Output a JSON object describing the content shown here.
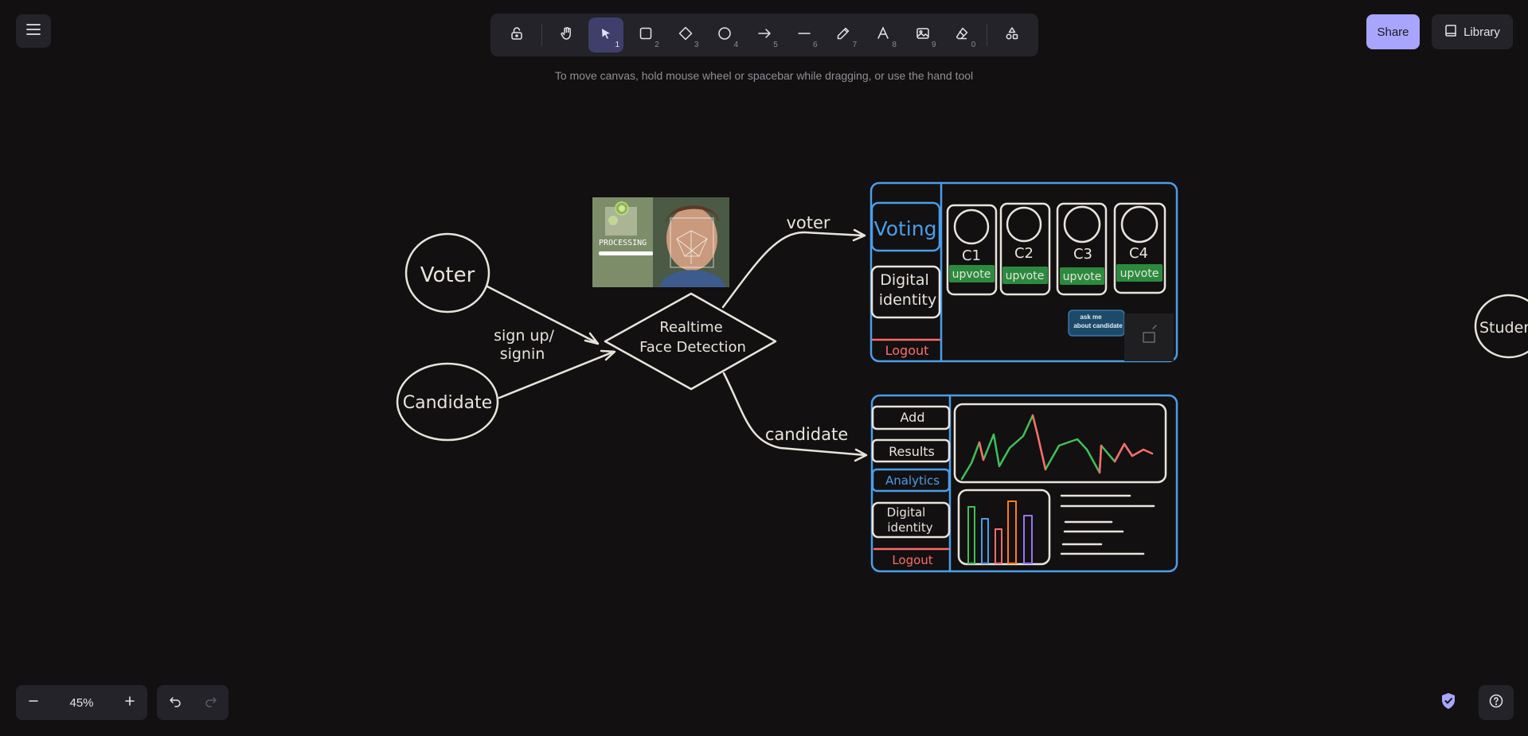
{
  "toolbar": {
    "tools": [
      {
        "name": "lock",
        "num": ""
      },
      {
        "name": "hand",
        "num": ""
      },
      {
        "name": "selection",
        "num": "1"
      },
      {
        "name": "rectangle",
        "num": "2"
      },
      {
        "name": "diamond",
        "num": "3"
      },
      {
        "name": "ellipse",
        "num": "4"
      },
      {
        "name": "arrow",
        "num": "5"
      },
      {
        "name": "line",
        "num": "6"
      },
      {
        "name": "draw",
        "num": "7"
      },
      {
        "name": "text",
        "num": "8"
      },
      {
        "name": "image",
        "num": "9"
      },
      {
        "name": "eraser",
        "num": "0"
      }
    ],
    "active_tool": "selection"
  },
  "hint": "To move canvas, hold mouse wheel or spacebar while dragging, or use the hand tool",
  "header": {
    "share_label": "Share",
    "library_label": "Library"
  },
  "footer": {
    "zoom": "45%"
  },
  "colors": {
    "background": "#121010",
    "stroke": "#e8e4dc",
    "blue": "#4a9eeb",
    "red": "#ff6b6b",
    "green": "#2f9e44",
    "accent": "#a8a5ff"
  },
  "canvas": {
    "voter": "Voter",
    "candidate": "Candidate",
    "signup_line1": "sign up/",
    "signup_line2": "signin",
    "detect_line1": "Realtime",
    "detect_line2": "Face Detection",
    "processing": "PROCESSING",
    "voter_arrow_label": "voter",
    "candidate_arrow_label": "candidate",
    "student_partial": "Studen",
    "voter_panel": {
      "voting": "Voting",
      "digital_line1": "Digital",
      "digital_line2": "identity",
      "logout": "Logout",
      "cards": [
        {
          "label": "C1",
          "upvote": "upvote"
        },
        {
          "label": "C2",
          "upvote": "upvote"
        },
        {
          "label": "C3",
          "upvote": "upvote"
        },
        {
          "label": "C4",
          "upvote": "upvote"
        }
      ],
      "ask_line1": "ask me",
      "ask_line2": "about candidate"
    },
    "candidate_panel": {
      "add": "Add",
      "results": "Results",
      "analytics": "Analytics",
      "digital_line1": "Digital",
      "digital_line2": "identity",
      "logout": "Logout"
    }
  }
}
